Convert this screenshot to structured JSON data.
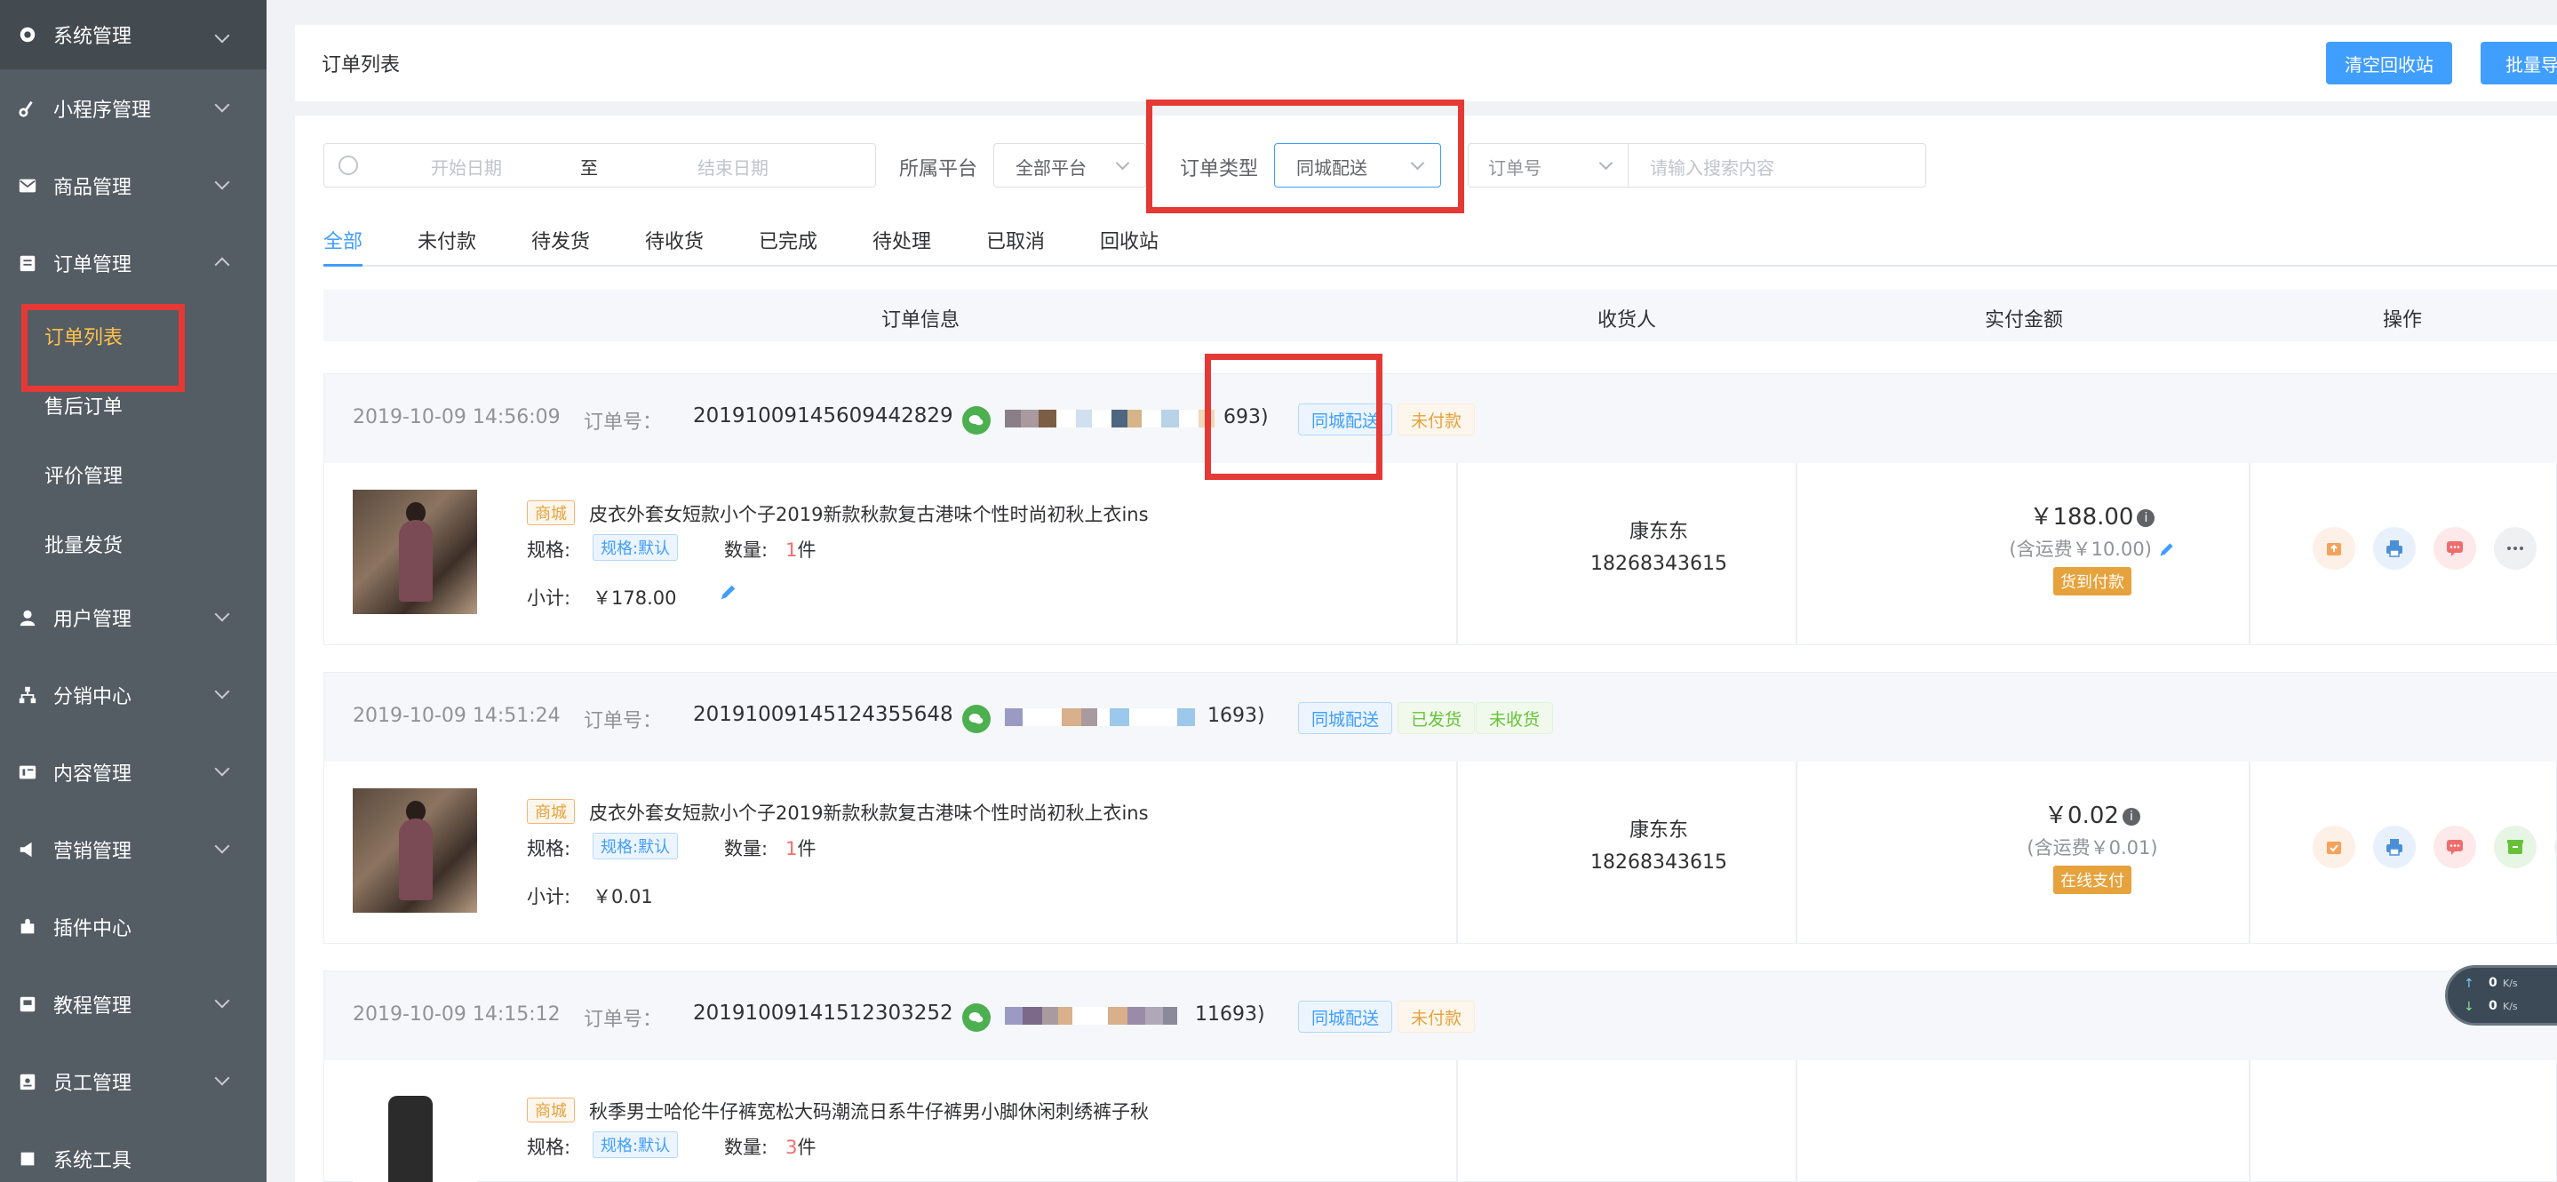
{
  "sidebar": {
    "items": [
      {
        "label": "系统管理",
        "icon": "gear-icon"
      },
      {
        "label": "小程序管理",
        "icon": "link-icon"
      },
      {
        "label": "商品管理",
        "icon": "mail-icon"
      },
      {
        "label": "订单管理",
        "icon": "clipboard-icon",
        "expanded": true
      },
      {
        "label": "用户管理",
        "icon": "user-icon"
      },
      {
        "label": "分销中心",
        "icon": "org-icon"
      },
      {
        "label": "内容管理",
        "icon": "content-icon"
      },
      {
        "label": "营销管理",
        "icon": "megaphone-icon"
      },
      {
        "label": "插件中心",
        "icon": "plugin-icon"
      },
      {
        "label": "教程管理",
        "icon": "book-icon"
      },
      {
        "label": "员工管理",
        "icon": "badge-icon"
      },
      {
        "label": "系统工具",
        "icon": "tool-icon"
      }
    ],
    "subitems": [
      {
        "label": "订单列表",
        "active": true
      },
      {
        "label": "售后订单"
      },
      {
        "label": "评价管理"
      },
      {
        "label": "批量发货"
      }
    ]
  },
  "header": {
    "title": "订单列表",
    "btn_clear": "清空回收站",
    "btn_export": "批量导出"
  },
  "filters": {
    "start_date": "开始日期",
    "to": "至",
    "end_date": "结束日期",
    "platform_label": "所属平台",
    "platform_value": "全部平台",
    "type_label": "订单类型",
    "type_value": "同城配送",
    "field_value": "订单号",
    "search_placeholder": "请输入搜索内容"
  },
  "tabs": [
    "全部",
    "未付款",
    "待发货",
    "待收货",
    "已完成",
    "待处理",
    "已取消",
    "回收站"
  ],
  "table": {
    "headers": [
      "订单信息",
      "收货人",
      "实付金额",
      "操作"
    ]
  },
  "labels": {
    "order_no": "订单号：",
    "spec": "规格:",
    "qty": "数量:",
    "subtotal": "小计:",
    "unit": "件"
  },
  "orders": [
    {
      "date": "2019-10-09 14:56:09",
      "order_no": "20191009145609442829",
      "user_tail": "693)",
      "tags": [
        "同城配送",
        "未付款"
      ],
      "shop": "商城",
      "goods": "皮衣外套女短款小个子2019新款秋款复古港味个性时尚初秋上衣ins",
      "spec": "规格:默认",
      "qty": "1",
      "subtotal": "￥178.00",
      "consignee": "康东东",
      "phone": "18268343615",
      "amount": "￥188.00",
      "shipping": "(含运费￥10.00)",
      "pay_tag": "货到付款"
    },
    {
      "date": "2019-10-09 14:51:24",
      "order_no": "20191009145124355648",
      "user_tail": "1693)",
      "tags": [
        "同城配送",
        "已发货",
        "未收货"
      ],
      "shop": "商城",
      "goods": "皮衣外套女短款小个子2019新款秋款复古港味个性时尚初秋上衣ins",
      "spec": "规格:默认",
      "qty": "1",
      "subtotal": "￥0.01",
      "consignee": "康东东",
      "phone": "18268343615",
      "amount": "￥0.02",
      "shipping": "(含运费￥0.01)",
      "pay_tag": "在线支付"
    },
    {
      "date": "2019-10-09 14:15:12",
      "order_no": "20191009141512303252",
      "user_tail": "11693)",
      "tags": [
        "同城配送",
        "未付款"
      ],
      "shop": "商城",
      "goods": "秋季男士哈伦牛仔裤宽松大码潮流日系牛仔裤男小脚休闲刺绣裤子秋",
      "spec": "规格:默认",
      "qty": "3"
    }
  ],
  "netmon": {
    "up": "0",
    "down": "0",
    "unit": "K/s"
  },
  "colors": {
    "accent": "#409eff",
    "sidebar_bg": "#545c64",
    "highlight": "#e53935",
    "active_menu": "#ffc24a"
  }
}
